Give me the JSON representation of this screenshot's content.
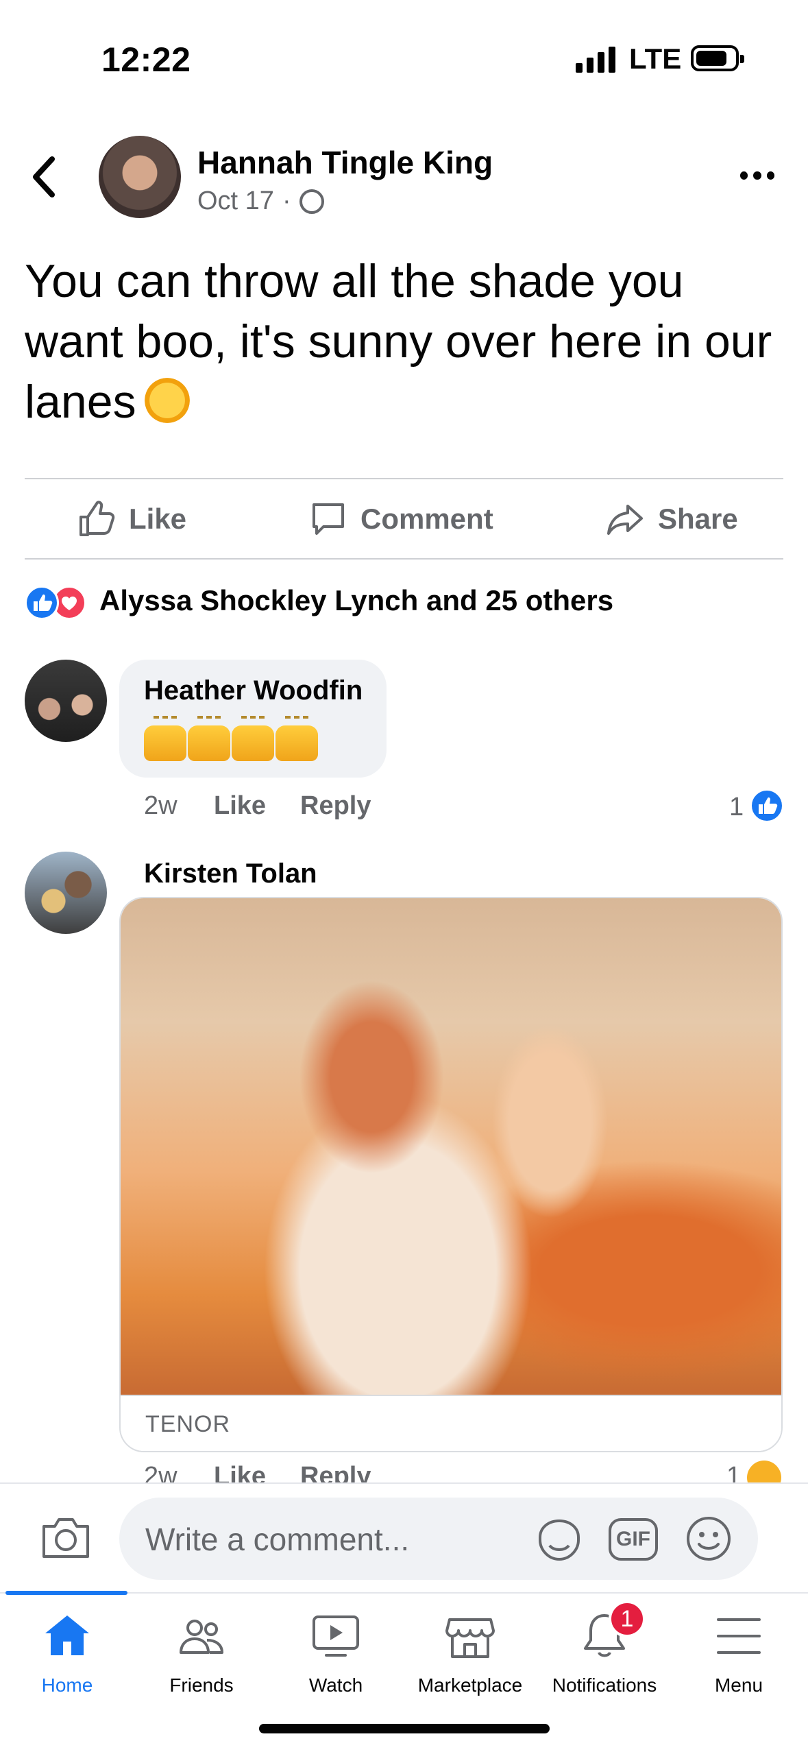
{
  "status_bar": {
    "time": "12:22",
    "network": "LTE"
  },
  "post": {
    "author": "Hannah Tingle King",
    "date": "Oct 17",
    "separator": "·",
    "text": "You can throw all the shade you want boo, it's sunny over here in our lanes",
    "actions": {
      "like": "Like",
      "comment": "Comment",
      "share": "Share"
    },
    "reactions_text": "Alyssa Shockley Lynch and 25 others"
  },
  "comments": [
    {
      "name": "Heather Woodfin",
      "time": "2w",
      "like": "Like",
      "reply": "Reply",
      "reaction_count": "1",
      "reaction": "like"
    },
    {
      "name": "Kirsten Tolan",
      "gif_source": "TENOR",
      "time": "2w",
      "like": "Like",
      "reply": "Reply",
      "reaction_count": "1",
      "reaction": "haha"
    }
  ],
  "composer": {
    "placeholder": "Write a comment...",
    "gif_label": "GIF"
  },
  "tabbar": {
    "tabs": [
      {
        "label": "Home",
        "icon": "home-icon",
        "active": true
      },
      {
        "label": "Friends",
        "icon": "friends-icon"
      },
      {
        "label": "Watch",
        "icon": "watch-icon"
      },
      {
        "label": "Marketplace",
        "icon": "marketplace-icon"
      },
      {
        "label": "Notifications",
        "icon": "bell-icon",
        "badge": "1"
      },
      {
        "label": "Menu",
        "icon": "menu-icon"
      }
    ]
  },
  "colors": {
    "accent": "#1877f2",
    "secondary_text": "#65676b",
    "badge": "#e41e3f",
    "bubble": "#f0f2f5"
  }
}
